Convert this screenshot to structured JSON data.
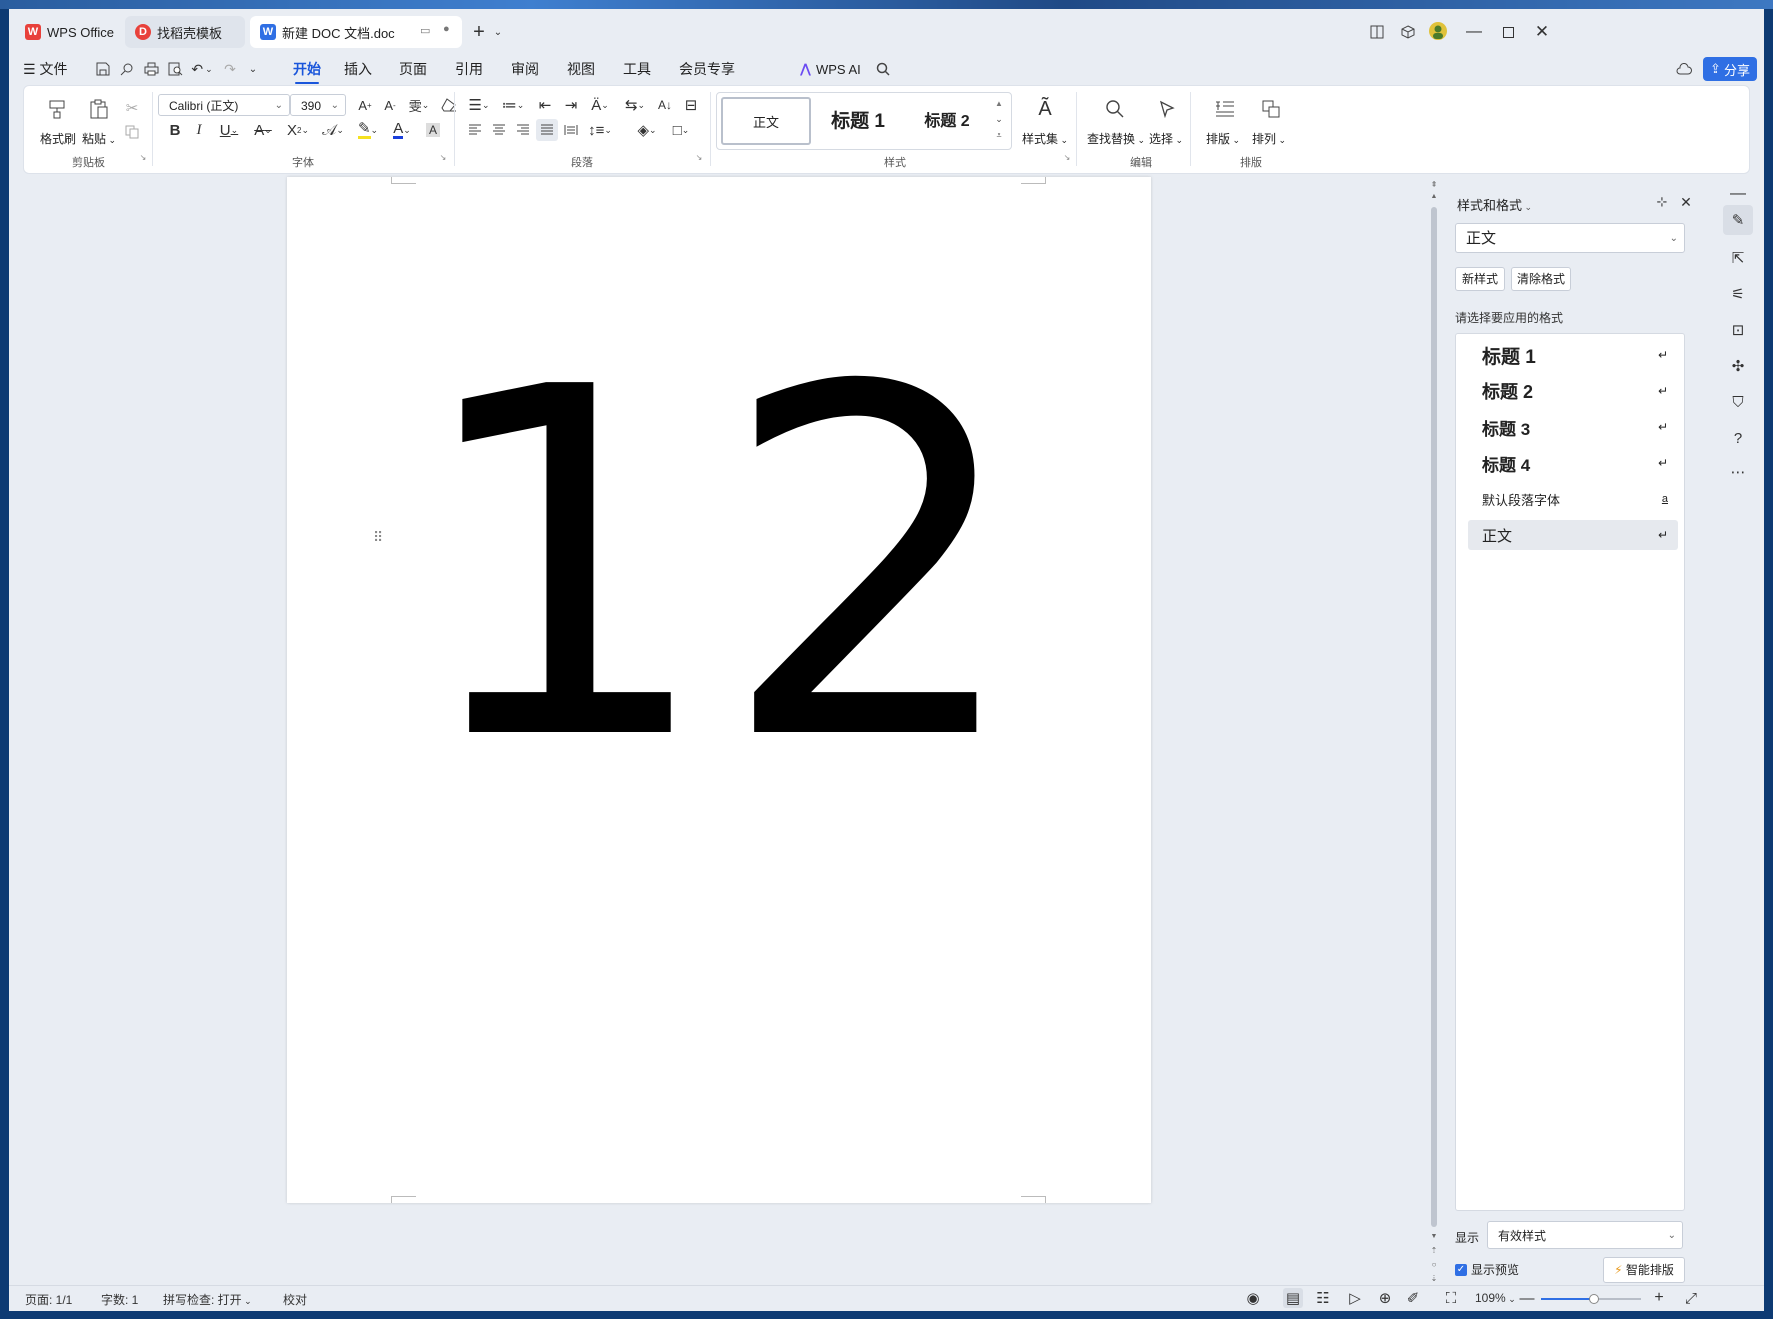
{
  "window": {
    "tabs": [
      {
        "label": "WPS Office",
        "icon": "wps-logo-icon"
      },
      {
        "label": "找稻壳模板",
        "icon": "docer-icon"
      },
      {
        "label": "新建 DOC 文档.doc",
        "icon": "word-doc-icon"
      }
    ],
    "controls": [
      "minimize",
      "maximize",
      "close"
    ]
  },
  "menu": {
    "file_label": "文件",
    "items": [
      "开始",
      "插入",
      "页面",
      "引用",
      "审阅",
      "视图",
      "工具",
      "会员专享"
    ],
    "active": "开始",
    "wps_ai_label": "WPS AI",
    "share_label": "分享"
  },
  "ribbon": {
    "clipboard": {
      "format_painter": "格式刷",
      "paste": "粘贴",
      "group": "剪贴板"
    },
    "font": {
      "font_name": "Calibri (正文)",
      "font_size": "390",
      "group": "字体"
    },
    "paragraph": {
      "group": "段落"
    },
    "styles": {
      "gallery": [
        "正文",
        "标题 1",
        "标题 2"
      ],
      "style_set": "样式集",
      "group": "样式"
    },
    "editing": {
      "find_replace": "查找替换",
      "select": "选择",
      "group": "编辑"
    },
    "layout": {
      "arrange": "排版",
      "order": "排列",
      "group": "排版"
    }
  },
  "document": {
    "content": "12"
  },
  "panel": {
    "title": "样式和格式",
    "current_style": "正文",
    "new_style": "新样式",
    "clear_format": "清除格式",
    "prompt": "请选择要应用的格式",
    "styles": [
      {
        "label": "标题 1",
        "kind": "heading1",
        "mark": "↵"
      },
      {
        "label": "标题 2",
        "kind": "heading2",
        "mark": "↵"
      },
      {
        "label": "标题 3",
        "kind": "heading3",
        "mark": "↵"
      },
      {
        "label": "标题 4",
        "kind": "heading4",
        "mark": "↵"
      },
      {
        "label": "默认段落字体",
        "kind": "char",
        "mark": "a"
      },
      {
        "label": "正文",
        "kind": "normal",
        "mark": "↵"
      }
    ],
    "show_label": "显示",
    "show_value": "有效样式",
    "preview_label": "显示预览",
    "smart_layout": "智能排版"
  },
  "status": {
    "page": "页面: 1/1",
    "words": "字数: 1",
    "spell": "拼写检查: 打开",
    "proof": "校对",
    "zoom": "109%"
  },
  "colors": {
    "accent": "#1a56db",
    "wps_red": "#e8413b"
  }
}
